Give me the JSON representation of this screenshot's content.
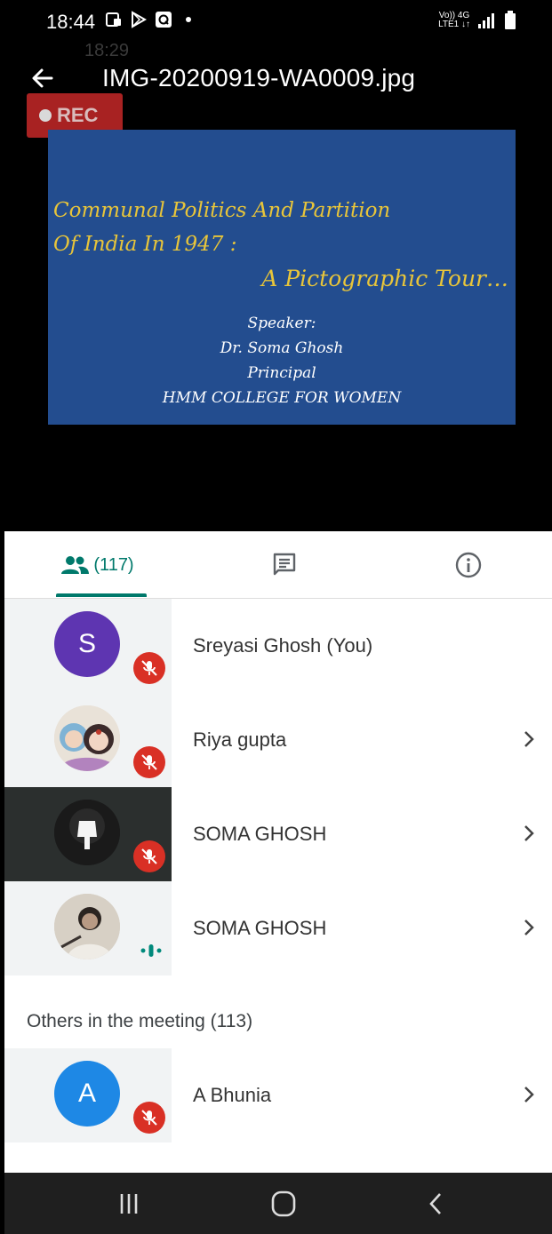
{
  "status_bar": {
    "time": "18:44",
    "ghost_time": "18:29",
    "network_top": "Vo)) 4G",
    "network_bottom": "LTE1 ↓↑"
  },
  "title_bar": {
    "file_name": "IMG-20200919-WA0009.jpg"
  },
  "video": {
    "rec_label": "REC",
    "slide": {
      "line1": "Communal Politics And Partition",
      "line2": "Of India In 1947 :",
      "line3": "A Pictographic Tour…",
      "speaker_label": "Speaker:",
      "speaker_name": "Dr. Soma Ghosh",
      "speaker_role": "Principal",
      "institution": "HMM COLLEGE FOR WOMEN"
    }
  },
  "tabs": {
    "people_count": "(117)"
  },
  "participants": [
    {
      "initial": "S",
      "name": "Sreyasi Ghosh (You)",
      "avatar_color": "#5e35b1",
      "status": "muted"
    },
    {
      "initial": "",
      "name": "Riya gupta",
      "status": "muted"
    },
    {
      "initial": "",
      "name": "SOMA GHOSH",
      "status": "muted"
    },
    {
      "initial": "",
      "name": "SOMA GHOSH",
      "status": "speaking"
    }
  ],
  "others_section": {
    "label": "Others in the meeting (113)"
  },
  "others": [
    {
      "initial": "A",
      "name": "A Bhunia",
      "avatar_color": "#1e88e5",
      "status": "muted"
    }
  ],
  "colors": {
    "accent": "#00796b",
    "mute_red": "#d93025",
    "slide_bg": "#234d8f",
    "slide_title": "#e8c53a"
  }
}
